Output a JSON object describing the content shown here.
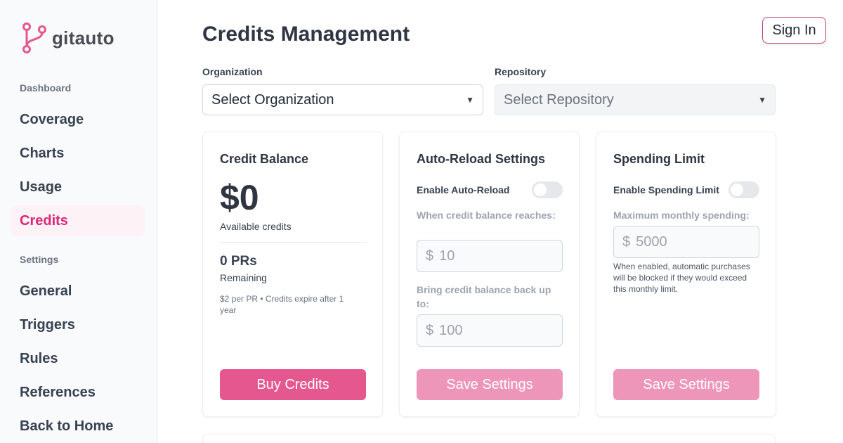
{
  "brand": {
    "name": "gitauto",
    "accent": "#e5588f"
  },
  "sidebar": {
    "sections": [
      {
        "label": "Dashboard"
      },
      {
        "label": "Settings"
      }
    ],
    "items": [
      {
        "label": "Coverage"
      },
      {
        "label": "Charts"
      },
      {
        "label": "Usage"
      },
      {
        "label": "Credits",
        "active": true
      },
      {
        "label": "General"
      },
      {
        "label": "Triggers"
      },
      {
        "label": "Rules"
      },
      {
        "label": "References"
      },
      {
        "label": "Back to Home"
      }
    ]
  },
  "header": {
    "title": "Credits Management",
    "sign_in": "Sign In"
  },
  "filters": {
    "organization": {
      "label": "Organization",
      "value": "Select Organization"
    },
    "repository": {
      "label": "Repository",
      "value": "Select Repository",
      "disabled": true
    }
  },
  "credit_balance": {
    "title": "Credit Balance",
    "amount": "$0",
    "amount_label": "Available credits",
    "prs": "0 PRs",
    "prs_label": "Remaining",
    "note": "$2 per PR • Credits expire after 1 year",
    "button": "Buy Credits"
  },
  "auto_reload": {
    "title": "Auto-Reload Settings",
    "toggle_label": "Enable Auto-Reload",
    "enabled": false,
    "threshold_label": "When credit balance reaches:",
    "threshold_currency": "$",
    "threshold_value": "10",
    "target_label": "Bring credit balance back up to:",
    "target_currency": "$",
    "target_value": "100",
    "button": "Save Settings"
  },
  "spending_limit": {
    "title": "Spending Limit",
    "toggle_label": "Enable Spending Limit",
    "enabled": false,
    "max_label": "Maximum monthly spending:",
    "max_currency": "$",
    "max_value": "5000",
    "help": "When enabled, automatic purchases will be blocked if they would exceed this monthly limit.",
    "button": "Save Settings"
  }
}
